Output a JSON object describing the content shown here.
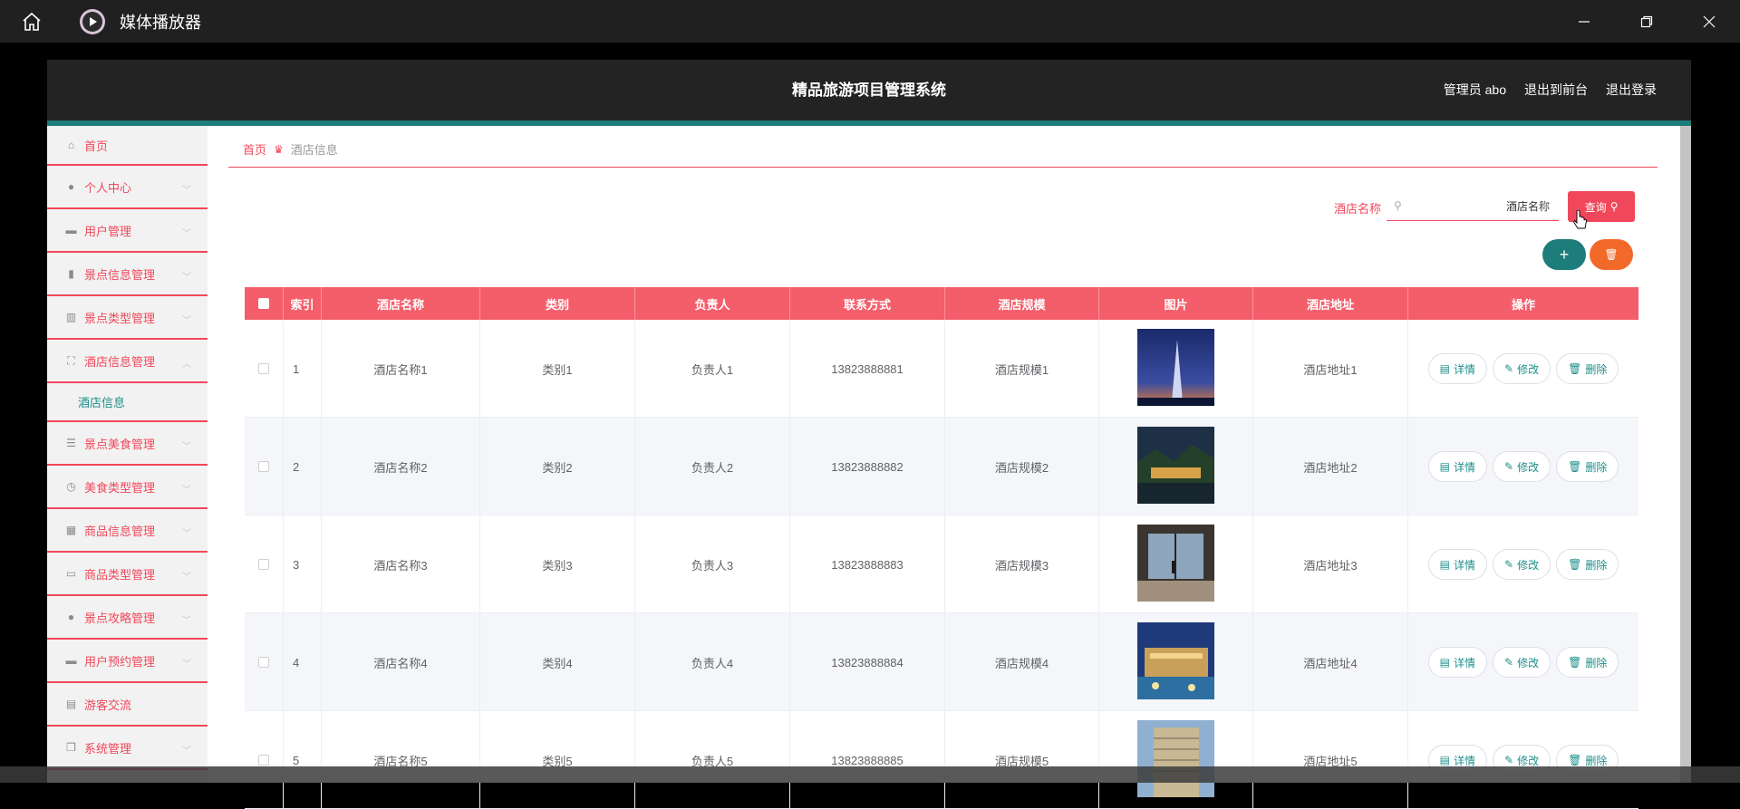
{
  "player": {
    "title": "媒体播放器",
    "icons": [
      "home-icon",
      "play-logo-icon",
      "minimize-icon",
      "maximize-icon",
      "close-icon"
    ]
  },
  "header": {
    "title": "精品旅游项目管理系统",
    "links": [
      "管理员 abo",
      "退出到前台",
      "退出登录"
    ]
  },
  "sidebar": {
    "items": [
      {
        "label": "首页",
        "icon": "home-icon"
      },
      {
        "label": "个人中心",
        "icon": "user-icon"
      },
      {
        "label": "用户管理",
        "icon": "briefcase-icon"
      },
      {
        "label": "景点信息管理",
        "icon": "clipboard-icon"
      },
      {
        "label": "景点类型管理",
        "icon": "bar-chart-icon"
      },
      {
        "label": "酒店信息管理",
        "icon": "expand-icon"
      },
      {
        "label": "景点美食管理",
        "icon": "list-icon"
      },
      {
        "label": "美食类型管理",
        "icon": "clock-icon"
      },
      {
        "label": "商品信息管理",
        "icon": "grid-icon"
      },
      {
        "label": "商品类型管理",
        "icon": "card-icon"
      },
      {
        "label": "景点攻略管理",
        "icon": "location-icon"
      },
      {
        "label": "用户预约管理",
        "icon": "calendar-icon"
      },
      {
        "label": "游客交流",
        "icon": "chat-icon"
      },
      {
        "label": "系统管理",
        "icon": "window-icon"
      }
    ],
    "sub_item": "酒店信息"
  },
  "breadcrumb": {
    "home": "首页",
    "current": "酒店信息"
  },
  "search": {
    "label": "酒店名称",
    "value": "酒店名称",
    "button": "查询"
  },
  "table": {
    "headers": [
      "索引",
      "酒店名称",
      "类别",
      "负责人",
      "联系方式",
      "酒店规模",
      "图片",
      "酒店地址",
      "操作"
    ],
    "actions": {
      "detail": "详情",
      "edit": "修改",
      "delete": "删除"
    },
    "rows": [
      {
        "index": "1",
        "name": "酒店名称1",
        "category": "类别1",
        "manager": "负责人1",
        "phone": "13823888881",
        "scale": "酒店规模1",
        "address": "酒店地址1"
      },
      {
        "index": "2",
        "name": "酒店名称2",
        "category": "类别2",
        "manager": "负责人2",
        "phone": "13823888882",
        "scale": "酒店规模2",
        "address": "酒店地址2"
      },
      {
        "index": "3",
        "name": "酒店名称3",
        "category": "类别3",
        "manager": "负责人3",
        "phone": "13823888883",
        "scale": "酒店规模3",
        "address": "酒店地址3"
      },
      {
        "index": "4",
        "name": "酒店名称4",
        "category": "类别4",
        "manager": "负责人4",
        "phone": "13823888884",
        "scale": "酒店规模4",
        "address": "酒店地址4"
      },
      {
        "index": "5",
        "name": "酒店名称5",
        "category": "类别5",
        "manager": "负责人5",
        "phone": "13823888885",
        "scale": "酒店规模5",
        "address": "酒店地址5"
      }
    ]
  },
  "colors": {
    "accent": "#f0485a",
    "teal": "#1d7d7a",
    "orange": "#f26a2a",
    "header_bg": "#232323"
  }
}
